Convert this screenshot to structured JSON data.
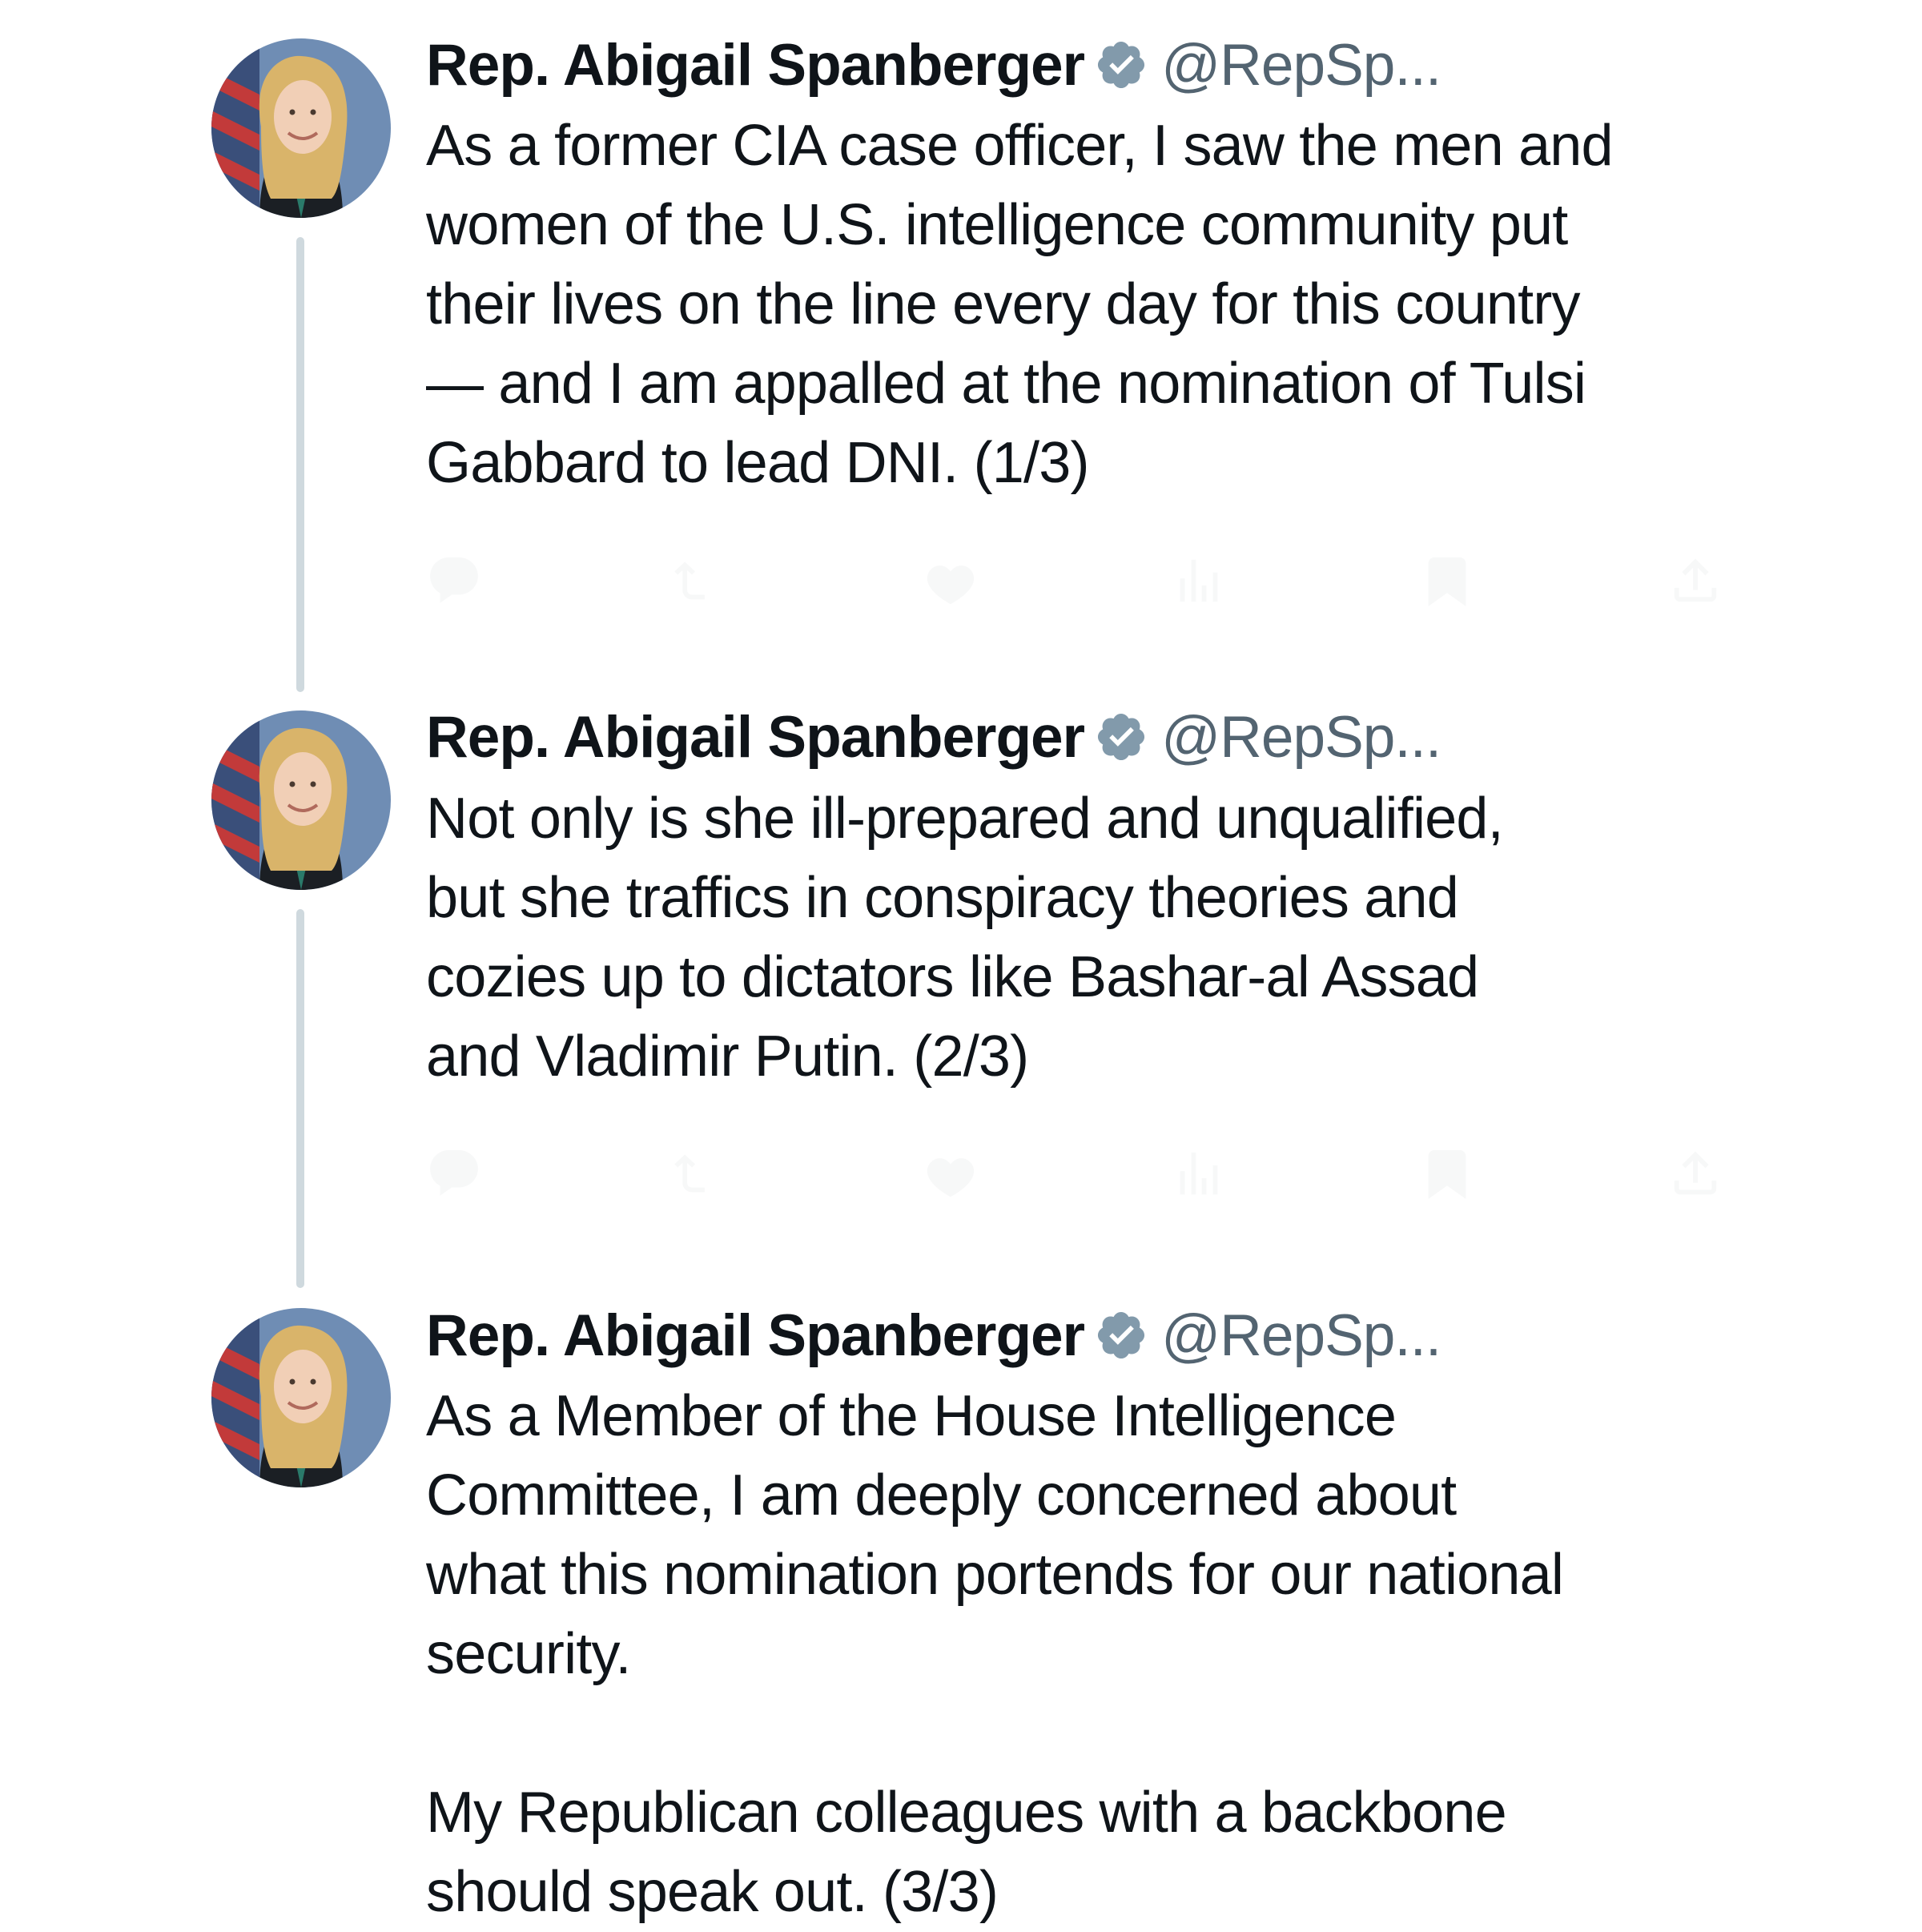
{
  "thread": {
    "tweets": [
      {
        "author_name": "Rep. Abigail Spanberger",
        "handle": "@RepSp...",
        "verified_icon": "verified-badge-icon",
        "text": "As a former CIA case officer, I saw the men and\nwomen of the U.S. intelligence community put\ntheir lives on the line every day for this country\n— and I am appalled at the nomination of Tulsi\nGabbard to lead DNI. (1/3)"
      },
      {
        "author_name": "Rep. Abigail Spanberger",
        "handle": "@RepSp...",
        "verified_icon": "verified-badge-icon",
        "text": "Not only is she ill-prepared and unqualified,\nbut she traffics in conspiracy theories and\ncozies up to dictators like Bashar-al Assad\nand Vladimir Putin. (2/3)"
      },
      {
        "author_name": "Rep. Abigail Spanberger",
        "handle": "@RepSp...",
        "verified_icon": "verified-badge-icon",
        "text": "As a Member of the House Intelligence\nCommittee, I am deeply concerned about\nwhat this nomination portends for our national\nsecurity.\n\nMy Republican colleagues with a backbone\nshould speak out. (3/3)"
      }
    ]
  },
  "icons": {
    "actions": [
      "reply-icon",
      "retweet-icon",
      "like-icon",
      "views-icon",
      "bookmark-icon",
      "share-icon"
    ]
  },
  "colors": {
    "text": "#0f1419",
    "secondary": "#536471",
    "verified": "#829aab",
    "thread_line": "#cfd9de"
  }
}
